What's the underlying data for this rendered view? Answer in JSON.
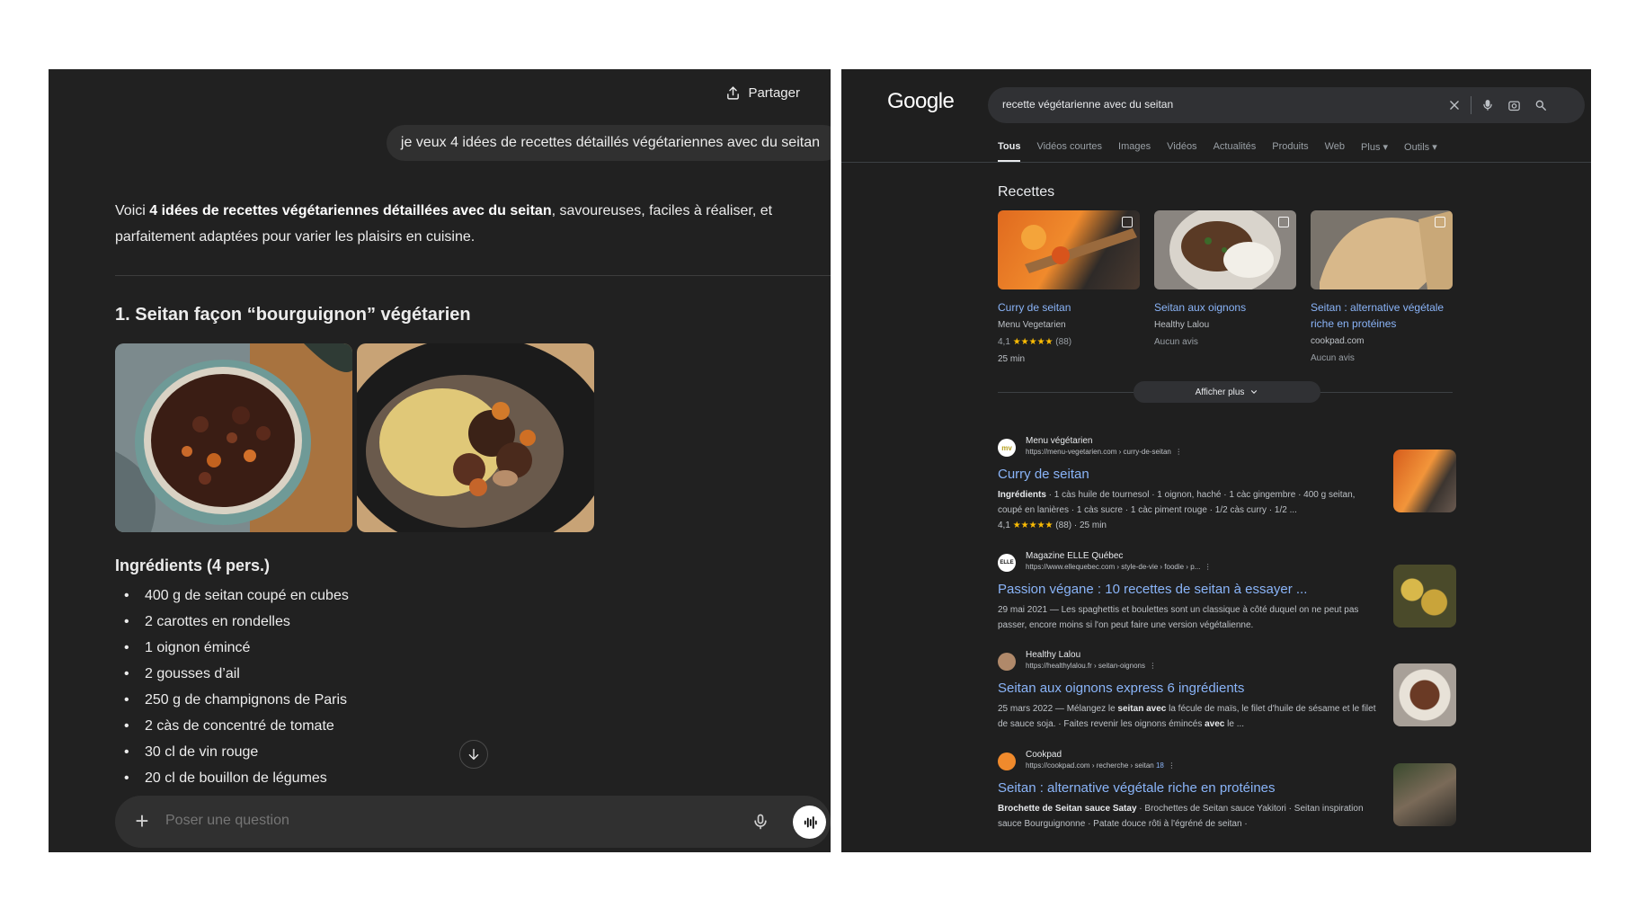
{
  "chat": {
    "share_label": "Partager",
    "user_message": "je veux 4 idées de recettes détaillés végétariennes avec du seitan",
    "intro_prefix": "Voici ",
    "intro_bold": "4 idées de recettes végétariennes détaillées avec du seitan",
    "intro_suffix": ", savoureuses, faciles à réaliser, et parfaitement adaptées pour varier les plaisirs en cuisine.",
    "recipe_title": "1. Seitan façon “bourguignon” végétarien",
    "ingredients_title": "Ingrédients (4 pers.)",
    "ingredients": [
      "400 g de seitan coupé en cubes",
      "2 carottes en rondelles",
      "1 oignon émincé",
      "2 gousses d’ail",
      "250 g de champignons de Paris",
      "2 càs de concentré de tomate",
      "30 cl de vin rouge",
      "20 cl de bouillon de légumes"
    ],
    "composer_placeholder": "Poser une question"
  },
  "google": {
    "logo": "Google",
    "query": "recette végétarienne avec du seitan",
    "tabs": [
      "Tous",
      "Vidéos courtes",
      "Images",
      "Vidéos",
      "Actualités",
      "Produits",
      "Web",
      "Plus ▾",
      "Outils ▾"
    ],
    "recipes_title": "Recettes",
    "recipe_cards": [
      {
        "title": "Curry de seitan",
        "source": "Menu Vegetarien",
        "rating": "4,1",
        "stars": "★★★★★",
        "count": "(88)",
        "time": "25 min"
      },
      {
        "title": "Seitan aux oignons",
        "source": "Healthy Lalou",
        "rating_text": "Aucun avis"
      },
      {
        "title": "Seitan : alternative végétale riche en protéines",
        "source": "cookpad.com",
        "rating_text": "Aucun avis"
      }
    ],
    "more_label": "Afficher plus",
    "results": [
      {
        "site": "Menu végétarien",
        "url": "https://menu-vegetarien.com › curry-de-seitan",
        "favicon": "mv",
        "title": "Curry de seitan",
        "snippet_bold": "Ingrédients",
        "snippet": " · 1 càs huile de tournesol · 1 oignon, haché · 1 càc gingembre · 400 g seitan, coupé en lanières · 1 càs sucre · 1 càc piment rouge · 1/2 càs curry · 1/2 ...",
        "rating": "4,1",
        "stars": "★★★★★",
        "rating_meta": "(88) · 25 min"
      },
      {
        "site": "Magazine ELLE Québec",
        "url": "https://www.ellequebec.com › style-de-vie › foodie › p...",
        "favicon": "ELLE",
        "title": "Passion végane : 10 recettes de seitan à essayer ...",
        "snippet": "29 mai 2021 — Les spaghettis et boulettes sont un classique à côté duquel on ne peut pas passer, encore moins si l'on peut faire une version végétalienne."
      },
      {
        "site": "Healthy Lalou",
        "url": "https://healthylalou.fr › seitan-oignons",
        "favicon": "",
        "title": "Seitan aux oignons express 6 ingrédients",
        "snippet_pre": "25 mars 2022 — Mélangez le ",
        "snippet_b1": "seitan avec",
        "snippet_mid": " la fécule de maïs, le filet d'huile de sésame et le filet de sauce soja. · Faites revenir les oignons émincés ",
        "snippet_b2": "avec",
        "snippet_post": " le ..."
      },
      {
        "site": "Cookpad",
        "url": "https://cookpad.com › recherche › seitan",
        "favicon": "",
        "badge": "18",
        "title": "Seitan : alternative végétale riche en protéines",
        "snippet_bold": "Brochette de Seitan sauce Satay",
        "snippet": " · Brochettes de Seitan sauce Yakitori · Seitan inspiration sauce Bourguignonne · Patate douce rôti à l'égréné de seitan ·"
      }
    ]
  }
}
